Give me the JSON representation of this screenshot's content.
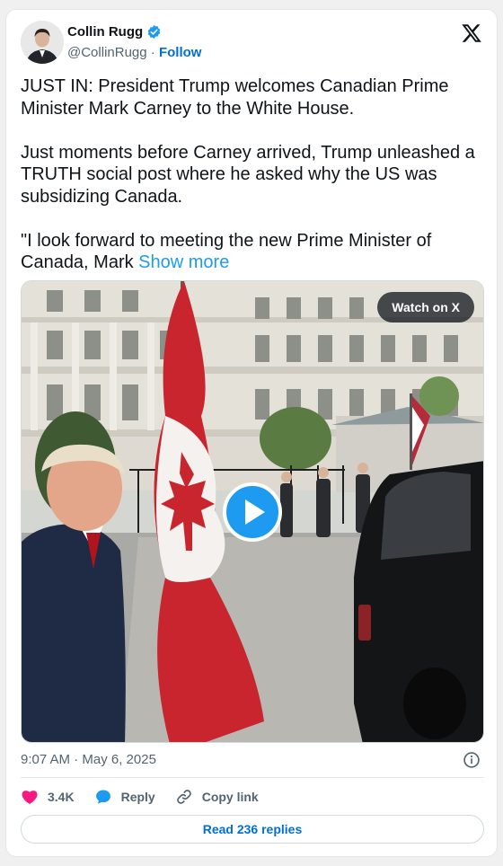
{
  "author": {
    "name": "Collin Rugg",
    "handle": "@CollinRugg",
    "separator": " · ",
    "follow_label": "Follow"
  },
  "post": {
    "text": "JUST IN: President Trump welcomes Canadian Prime Minister Mark Carney to the White House.\n\nJust moments before Carney arrived, Trump unleashed a TRUTH social post where he asked why the US was subsidizing Canada.\n\n\"I look forward to meeting the new Prime Minister of Canada, Mark ",
    "show_more_label": "Show more"
  },
  "media": {
    "watch_label": "Watch on X"
  },
  "meta": {
    "timestamp": "9:07 AM · May 6, 2025"
  },
  "actions": {
    "likes": "3.4K",
    "reply_label": "Reply",
    "copy_label": "Copy link"
  },
  "read_replies_label": "Read 236 replies",
  "colors": {
    "like": "#f91880",
    "reply": "#1d9bf0",
    "link": "#006fd6",
    "show_more": "#1d9bf0",
    "verified": "#1d9bf0"
  },
  "icons": [
    "verified-icon",
    "x-logo-icon",
    "play-icon",
    "info-icon",
    "heart-icon",
    "reply-icon",
    "link-icon"
  ]
}
